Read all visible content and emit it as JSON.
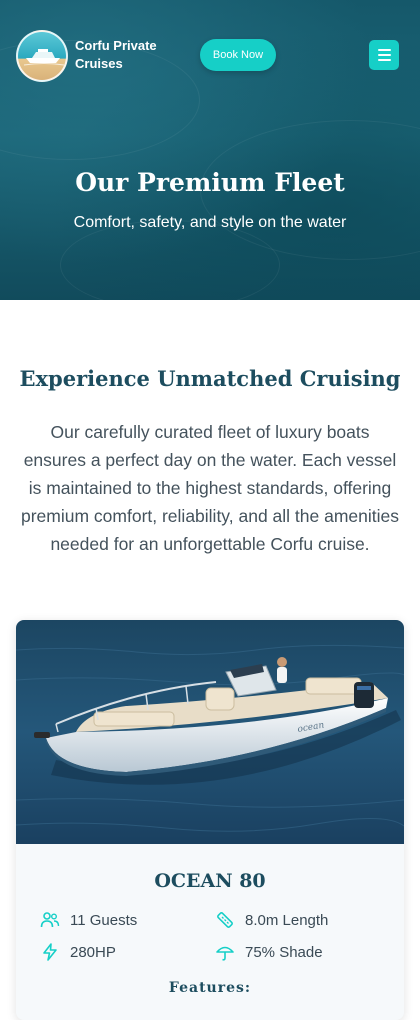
{
  "header": {
    "brand_name": "Corfu Private Cruises",
    "book_label": "Book Now",
    "menu_icon": "hamburger-menu-icon"
  },
  "hero": {
    "title": "Our Premium Fleet",
    "subtitle": "Comfort, safety, and style on the water"
  },
  "intro": {
    "title": "Experience Unmatched Cruising",
    "text": "Our carefully curated fleet of luxury boats ensures a perfect day on the water. Each vessel is maintained to the highest standards, offering premium comfort, reliability, and all the amenities needed for an unforgettable Corfu cruise."
  },
  "boat": {
    "name": "OCEAN 80",
    "specs": [
      {
        "icon": "guests-icon",
        "label": "11 Guests"
      },
      {
        "icon": "ruler-icon",
        "label": "8.0m Length"
      },
      {
        "icon": "power-icon",
        "label": "280HP"
      },
      {
        "icon": "umbrella-icon",
        "label": "75% Shade"
      }
    ],
    "features_heading": "Features:"
  },
  "colors": {
    "accent": "#16cfc7",
    "heading": "#1d4d5f",
    "hero_bg": "#1b6577"
  }
}
